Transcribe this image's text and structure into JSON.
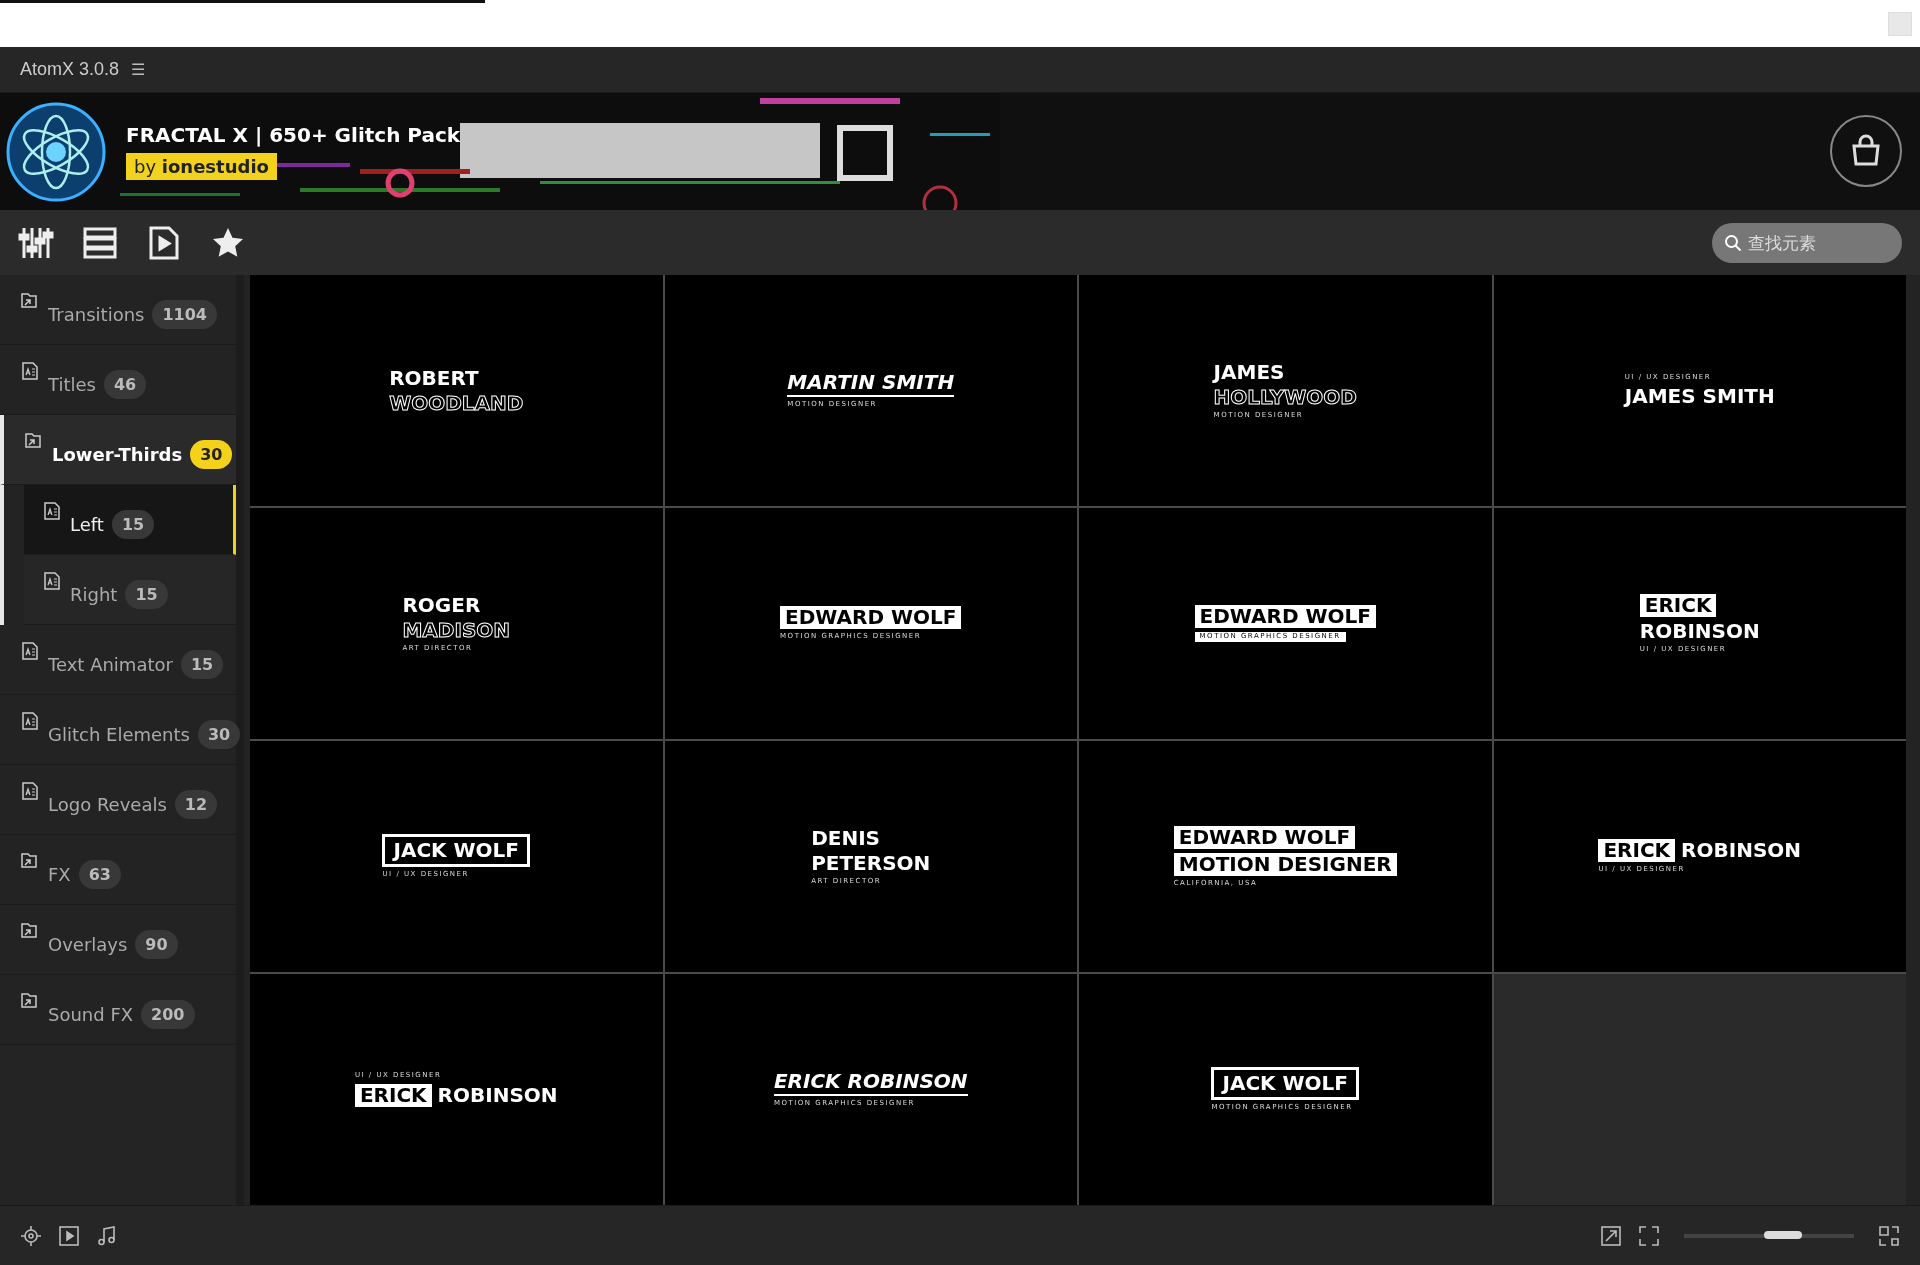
{
  "app": {
    "title": "AtomX 3.0.8",
    "menu_glyph": "☰"
  },
  "pack": {
    "title": "FRACTAL X | 650+ Glitch Pack",
    "author_prefix": "by",
    "author": "ionestudio"
  },
  "search": {
    "placeholder": "查找元素"
  },
  "sidebar": {
    "items": [
      {
        "label": "Transitions",
        "count": "1104",
        "kind": "folder",
        "selected": false
      },
      {
        "label": "Titles",
        "count": "46",
        "kind": "project",
        "selected": false
      },
      {
        "label": "Lower-Thirds",
        "count": "30",
        "kind": "folder",
        "selected": true,
        "expanded": true,
        "children": [
          {
            "label": "Left",
            "count": "15",
            "kind": "project",
            "selected": true
          },
          {
            "label": "Right",
            "count": "15",
            "kind": "project",
            "selected": false
          }
        ]
      },
      {
        "label": "Text Animator",
        "count": "15",
        "kind": "project",
        "selected": false
      },
      {
        "label": "Glitch Elements",
        "count": "30",
        "kind": "project",
        "selected": false
      },
      {
        "label": "Logo Reveals",
        "count": "12",
        "kind": "project",
        "selected": false
      },
      {
        "label": "FX",
        "count": "63",
        "kind": "folder",
        "selected": false
      },
      {
        "label": "Overlays",
        "count": "90",
        "kind": "folder",
        "selected": false
      },
      {
        "label": "Sound FX",
        "count": "200",
        "kind": "folder",
        "selected": false
      }
    ]
  },
  "tiles": [
    {
      "lines": [
        {
          "parts": [
            {
              "text": "ROBERT",
              "kind": "name"
            }
          ]
        },
        {
          "parts": [
            {
              "text": "WOODLAND",
              "kind": "outline"
            }
          ]
        }
      ]
    },
    {
      "lines": [
        {
          "parts": [
            {
              "text": "MARTIN SMITH",
              "kind": "italic"
            }
          ]
        },
        {
          "parts": [
            {
              "text": "MOTION DESIGNER",
              "kind": "caption"
            }
          ]
        }
      ]
    },
    {
      "lines": [
        {
          "parts": [
            {
              "text": "JAMES",
              "kind": "name"
            }
          ]
        },
        {
          "parts": [
            {
              "text": "HOLLYWOOD",
              "kind": "outline"
            }
          ]
        },
        {
          "parts": [
            {
              "text": "MOTION DESIGNER",
              "kind": "caption"
            }
          ]
        }
      ]
    },
    {
      "lines": [
        {
          "parts": [
            {
              "text": "UI / UX DESIGNER",
              "kind": "caption"
            }
          ]
        },
        {
          "parts": [
            {
              "text": "JAMES SMITH",
              "kind": "name"
            }
          ]
        }
      ]
    },
    {
      "lines": [
        {
          "parts": [
            {
              "text": "ROGER",
              "kind": "name"
            }
          ]
        },
        {
          "parts": [
            {
              "text": "MADISON",
              "kind": "outline"
            }
          ]
        },
        {
          "parts": [
            {
              "text": "ART DIRECTOR",
              "kind": "caption"
            }
          ]
        }
      ]
    },
    {
      "lines": [
        {
          "parts": [
            {
              "text": "EDWARD WOLF",
              "kind": "boxed"
            }
          ]
        },
        {
          "parts": [
            {
              "text": "MOTION GRAPHICS DESIGNER",
              "kind": "caption"
            }
          ]
        }
      ]
    },
    {
      "lines": [
        {
          "parts": [
            {
              "text": "EDWARD WOLF",
              "kind": "boxed"
            }
          ]
        },
        {
          "parts": [
            {
              "text": "MOTION GRAPHICS DESIGNER",
              "kind": "boxcaption"
            }
          ]
        }
      ]
    },
    {
      "lines": [
        {
          "parts": [
            {
              "text": "ERICK",
              "kind": "boxed"
            }
          ]
        },
        {
          "parts": [
            {
              "text": "ROBINSON",
              "kind": "name"
            }
          ]
        },
        {
          "parts": [
            {
              "text": "UI / UX DESIGNER",
              "kind": "caption"
            }
          ]
        }
      ]
    },
    {
      "lines": [
        {
          "parts": [
            {
              "text": "JACK WOLF",
              "kind": "framed"
            }
          ]
        },
        {
          "parts": [
            {
              "text": "UI / UX DESIGNER",
              "kind": "caption"
            }
          ]
        }
      ]
    },
    {
      "lines": [
        {
          "parts": [
            {
              "text": "DENIS",
              "kind": "name"
            }
          ]
        },
        {
          "parts": [
            {
              "text": "PETERSON",
              "kind": "name"
            }
          ]
        },
        {
          "parts": [
            {
              "text": "ART DIRECTOR",
              "kind": "caption"
            }
          ]
        }
      ]
    },
    {
      "lines": [
        {
          "parts": [
            {
              "text": "EDWARD WOLF",
              "kind": "boxed"
            }
          ]
        },
        {
          "parts": [
            {
              "text": "MOTION DESIGNER",
              "kind": "boxed"
            }
          ]
        },
        {
          "parts": [
            {
              "text": "CALIFORNIA, USA",
              "kind": "caption"
            }
          ]
        }
      ]
    },
    {
      "lines": [
        {
          "parts": [
            {
              "text": "ERICK",
              "kind": "boxed"
            },
            {
              "text": "ROBINSON",
              "kind": "name"
            }
          ]
        },
        {
          "parts": [
            {
              "text": "UI / UX DESIGNER",
              "kind": "caption"
            }
          ]
        }
      ]
    },
    {
      "lines": [
        {
          "parts": [
            {
              "text": "UI / UX DESIGNER",
              "kind": "caption"
            }
          ]
        },
        {
          "parts": [
            {
              "text": "ERICK",
              "kind": "boxed"
            },
            {
              "text": "ROBINSON",
              "kind": "name"
            }
          ]
        }
      ]
    },
    {
      "lines": [
        {
          "parts": [
            {
              "text": "ERICK ROBINSON",
              "kind": "italic"
            }
          ]
        },
        {
          "parts": [
            {
              "text": "MOTION GRAPHICS DESIGNER",
              "kind": "caption"
            }
          ]
        }
      ]
    },
    {
      "lines": [
        {
          "parts": [
            {
              "text": "JACK WOLF",
              "kind": "framed"
            }
          ]
        },
        {
          "parts": [
            {
              "text": "MOTION GRAPHICS DESIGNER",
              "kind": "caption"
            }
          ]
        }
      ]
    }
  ],
  "zoom_slider": {
    "level": 0.58
  }
}
